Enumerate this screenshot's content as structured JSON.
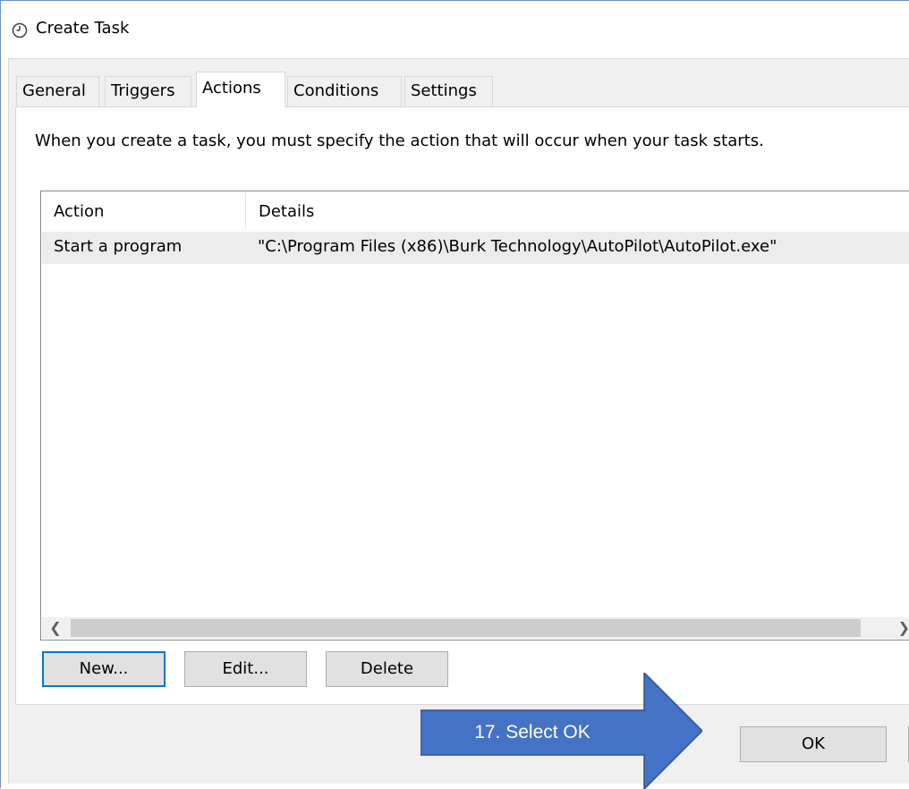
{
  "window": {
    "title": "Create Task",
    "icon": "clock-icon"
  },
  "tabs": [
    {
      "label": "General",
      "active": false
    },
    {
      "label": "Triggers",
      "active": false
    },
    {
      "label": "Actions",
      "active": true
    },
    {
      "label": "Conditions",
      "active": false
    },
    {
      "label": "Settings",
      "active": false
    }
  ],
  "actions_page": {
    "intro": "When you create a task, you must specify the action that will occur when your task starts.",
    "columns": [
      "Action",
      "Details"
    ],
    "rows": [
      {
        "action": "Start a program",
        "details": "\"C:\\Program Files (x86)\\Burk Technology\\AutoPilot\\AutoPilot.exe\""
      }
    ],
    "buttons": {
      "new": "New...",
      "edit": "Edit...",
      "delete": "Delete"
    }
  },
  "footer": {
    "ok": "OK"
  },
  "callout": {
    "text": "17. Select OK",
    "color": "#4472c4"
  }
}
